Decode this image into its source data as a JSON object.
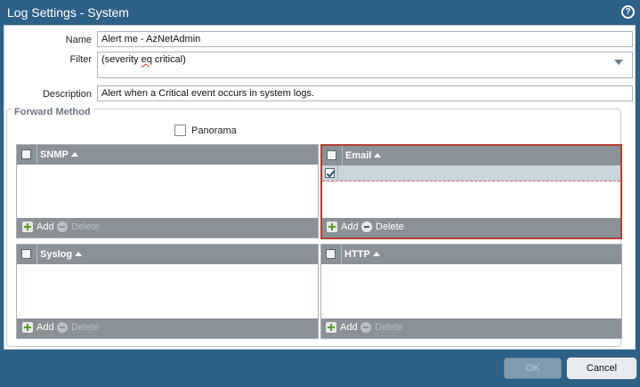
{
  "dialog": {
    "title": "Log Settings - System"
  },
  "form": {
    "name_label": "Name",
    "name_value": "Alert me - AzNetAdmin",
    "filter_label": "Filter",
    "filter_prefix": "(severity ",
    "filter_keyword": "eq",
    "filter_suffix": " critical)",
    "description_label": "Description",
    "description_value": "Alert when a Critical event occurs in system logs."
  },
  "forward_method": {
    "legend": "Forward Method",
    "panorama_label": "Panorama",
    "panels": {
      "snmp": {
        "title": "SNMP",
        "add": "Add",
        "delete": "Delete"
      },
      "email": {
        "title": "Email",
        "add": "Add",
        "delete": "Delete",
        "rows": [
          {
            "checked": true,
            "value": ""
          }
        ]
      },
      "syslog": {
        "title": "Syslog",
        "add": "Add",
        "delete": "Delete"
      },
      "http": {
        "title": "HTTP",
        "add": "Add",
        "delete": "Delete"
      }
    }
  },
  "buttons": {
    "ok": "OK",
    "cancel": "Cancel"
  },
  "colors": {
    "title_bar": "#2d6188",
    "panel_header": "#8a9297",
    "email_focus_border": "#b4402f"
  }
}
